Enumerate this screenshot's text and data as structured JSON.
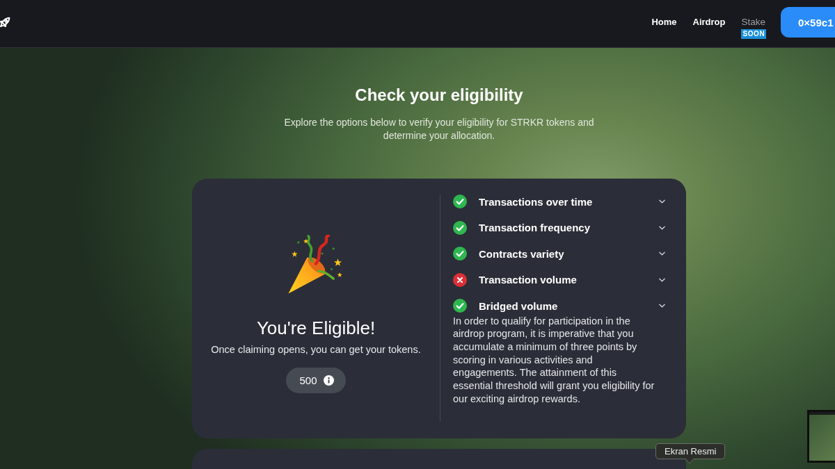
{
  "header": {
    "nav": [
      {
        "label": "Home",
        "disabled": false
      },
      {
        "label": "Airdrop",
        "disabled": false
      },
      {
        "label": "Stake",
        "disabled": true,
        "badge": "SOON"
      }
    ],
    "wallet_button": "0×59c1"
  },
  "hero": {
    "title": "Check your eligibility",
    "subtitle": "Explore the options below to verify your eligibility for STRKR tokens and determine your allocation."
  },
  "card": {
    "title": "You're Eligible!",
    "message": "Once claiming opens, you can get your tokens.",
    "amount": "500",
    "criteria": [
      {
        "label": "Transactions over time",
        "passed": true,
        "expanded": false
      },
      {
        "label": "Transaction frequency",
        "passed": true,
        "expanded": false
      },
      {
        "label": "Contracts variety",
        "passed": true,
        "expanded": false
      },
      {
        "label": "Transaction volume",
        "passed": false,
        "expanded": false
      },
      {
        "label": "Bridged volume",
        "passed": true,
        "expanded": false
      }
    ],
    "description": "In order to qualify for participation in the airdrop program, it is imperative that you accumulate a minimum of three points by scoring in various activities and engagements. The attainment of this essential threshold will grant you eligibility for our exciting airdrop rewards."
  },
  "tooltip": {
    "text": "Ekran Resmi"
  }
}
